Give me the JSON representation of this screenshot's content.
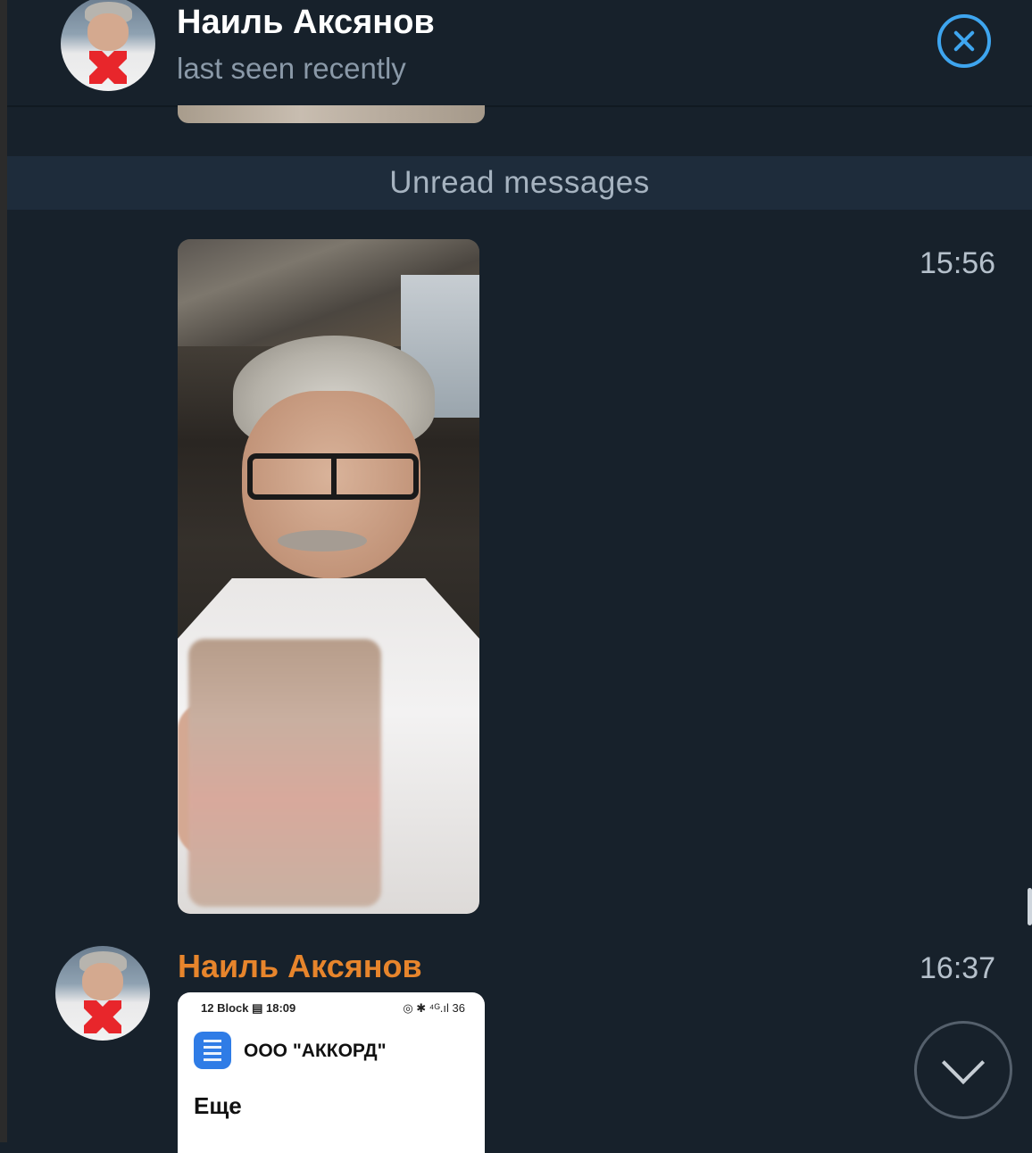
{
  "header": {
    "name": "Наиль Аксянов",
    "status": "last seen recently",
    "close_icon": "close-circle-icon"
  },
  "banner": {
    "text": "Unread messages"
  },
  "messages": [
    {
      "type": "photo",
      "time": "15:56"
    },
    {
      "type": "photo",
      "sender": "Наиль Аксянов",
      "time": "16:37",
      "screenshot": {
        "status_left": "12 Block ▤ 18:09",
        "status_right": "◎ ✱ ⁴ᴳ.ıl 36",
        "company": "ООО \"АККОРД\"",
        "heading": "Еще"
      }
    }
  ],
  "colors": {
    "background": "#17212b",
    "banner": "#1e2c3b",
    "accent": "#3ea5ef",
    "sender_name": "#e7852c"
  },
  "scroll_button": {
    "icon": "chevron-down-icon"
  }
}
